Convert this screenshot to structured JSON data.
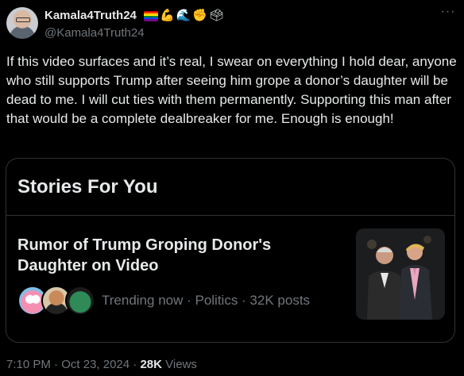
{
  "post": {
    "author": {
      "display_name": "Kamala4Truth24",
      "handle": "@Kamala4Truth24",
      "emojis": [
        "rainbow-flag",
        "flexed-biceps",
        "wave",
        "raised-fist",
        "ballot-box"
      ]
    },
    "more_icon": "more-horizontal-icon",
    "text": "If this video surfaces and it’s real, I swear on everything I hold dear, anyone who still supports Trump after seeing him grope a donor’s daughter will be dead to me. I will cut ties with them permanently. Supporting this man after that would be a complete dealbreaker for me. Enough is enough!",
    "card": {
      "header": "Stories For You",
      "story": {
        "title": "Rumor of Trump Groping Donor's Daughter on Video",
        "trending_text": "Trending now · Politics · 32K posts",
        "avatar_icons": [
          "powerpuff-avatar",
          "person-avatar",
          "green-character-avatar"
        ]
      }
    },
    "meta": {
      "time": "7:10 PM",
      "separator": " · ",
      "date": "Oct 23, 2024",
      "views_count": "28K",
      "views_label": " Views"
    }
  },
  "colors": {
    "background": "#000000",
    "text": "#e7e9ea",
    "secondary_text": "#71767b",
    "border": "#2f3336"
  }
}
